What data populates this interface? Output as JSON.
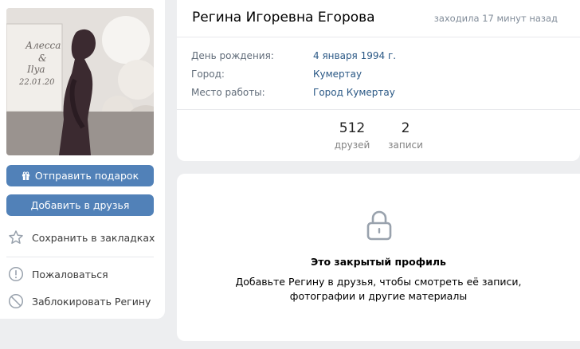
{
  "profile": {
    "name": "Регина Игоревна Егорова",
    "last_seen": "заходила 17 минут назад",
    "info": [
      {
        "label": "День рождения:",
        "value": "4 января 1994 г."
      },
      {
        "label": "Город:",
        "value": "Кумертау"
      },
      {
        "label": "Место работы:",
        "value": "Город Кумертау"
      }
    ],
    "stats": [
      {
        "count": "512",
        "label": "друзей"
      },
      {
        "count": "2",
        "label": "записи"
      }
    ]
  },
  "photo": {
    "text_line1": "Алесса",
    "text_amp": "&",
    "text_line2": "Ilya",
    "text_date": "22.01.20"
  },
  "actions": {
    "send_gift": "Отправить подарок",
    "add_friend": "Добавить в друзья",
    "bookmark": "Сохранить в закладках",
    "report": "Пожаловаться",
    "block": "Заблокировать Регину"
  },
  "closed_profile": {
    "title": "Это закрытый профиль",
    "description_line1": "Добавьте Регину в друзья, чтобы смотреть её записи,",
    "description_line2": "фотографии и другие материалы"
  },
  "colors": {
    "accent": "#5181b8",
    "link": "#2a5885",
    "background": "#edeef0"
  }
}
